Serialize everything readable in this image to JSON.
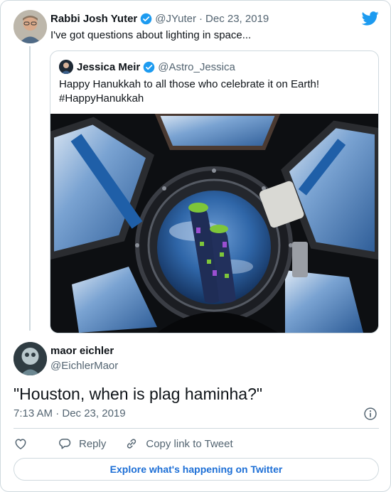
{
  "parent": {
    "name": "Rabbi Josh Yuter",
    "handle": "@JYuter",
    "separator": "·",
    "date": "Dec 23, 2019",
    "text": "I've got questions about lighting in space..."
  },
  "quoted": {
    "name": "Jessica Meir",
    "handle": "@Astro_Jessica",
    "text_line1": "Happy Hanukkah to all those who celebrate it on Earth!",
    "text_line2": "#HappyHanukkah"
  },
  "reply": {
    "name": "maor eichler",
    "handle": "@EichlerMaor",
    "text": "\"Houston, when is plag haminha?\"",
    "timestamp": "7:13 AM · Dec 23, 2019"
  },
  "actions": {
    "reply_label": "Reply",
    "copy_label": "Copy link to Tweet"
  },
  "explore_label": "Explore what's happening on Twitter",
  "icons": {
    "brand": "twitter-bird-icon",
    "verified": "verified-badge-icon",
    "info": "info-icon",
    "like": "heart-icon",
    "reply": "reply-bubble-icon",
    "copy": "link-icon"
  },
  "colors": {
    "accent": "#1d9bf0",
    "link": "#1d6fd6",
    "muted": "#536471",
    "border": "#cfd9de"
  }
}
